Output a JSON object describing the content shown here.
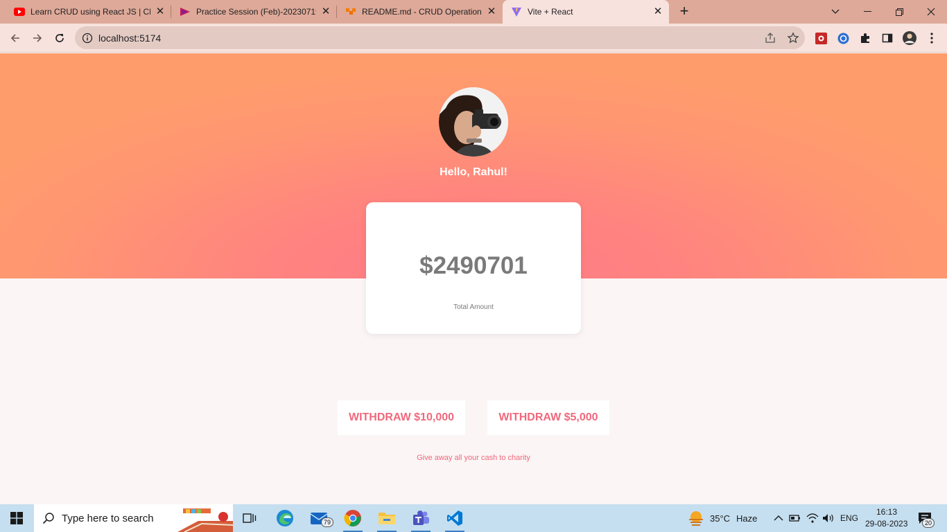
{
  "browser": {
    "tabs": [
      {
        "title": "Learn CRUD using React JS | CRU",
        "icon": "youtube-icon",
        "active": false
      },
      {
        "title": "Practice Session (Feb)-20230719_",
        "icon": "play-triangle-icon",
        "active": false
      },
      {
        "title": "README.md - CRUD Operation-R",
        "icon": "gitlab-icon",
        "active": false
      },
      {
        "title": "Vite + React",
        "icon": "vite-icon",
        "active": true
      }
    ],
    "address": "localhost:5174"
  },
  "app": {
    "greeting": "Hello, Rahul!",
    "amount": "$2490701",
    "amount_label": "Total Amount",
    "buttons": {
      "withdraw_10000": "WITHDRAW $10,000",
      "withdraw_5000": "WITHDRAW $5,000"
    },
    "charity_link": "Give away all your cash to charity",
    "accent_color": "#f0687c",
    "hero_colors": [
      "#ff9c6c",
      "#ff7a85"
    ]
  },
  "taskbar": {
    "search_placeholder": "Type here to search",
    "mail_badge": "79",
    "weather": {
      "temp": "35°C",
      "condition": "Haze"
    },
    "language": "ENG",
    "time": "16:13",
    "date": "29-08-2023",
    "notification_count": "20"
  }
}
